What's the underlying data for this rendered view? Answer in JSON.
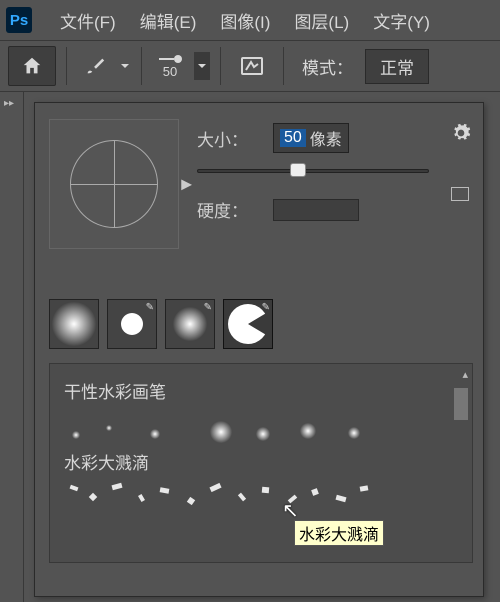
{
  "app": {
    "name": "Ps"
  },
  "menu": {
    "file": "文件(F)",
    "edit": "编辑(E)",
    "image": "图像(I)",
    "layer": "图层(L)",
    "type": "文字(Y)"
  },
  "toolbar": {
    "brush_size": "50",
    "mode_label": "模式：",
    "mode_value": "正常"
  },
  "brush_panel": {
    "size_label": "大小：",
    "size_value": "50",
    "size_unit": "像素",
    "hardness_label": "硬度：",
    "slider_pos_pct": 40
  },
  "groups": {
    "g1_title": "干性水彩画笔",
    "g2_title": "水彩大溅滴"
  },
  "tooltip": "水彩大溅滴",
  "icons": {
    "home": "home",
    "brush": "brush",
    "gear": "gear"
  }
}
